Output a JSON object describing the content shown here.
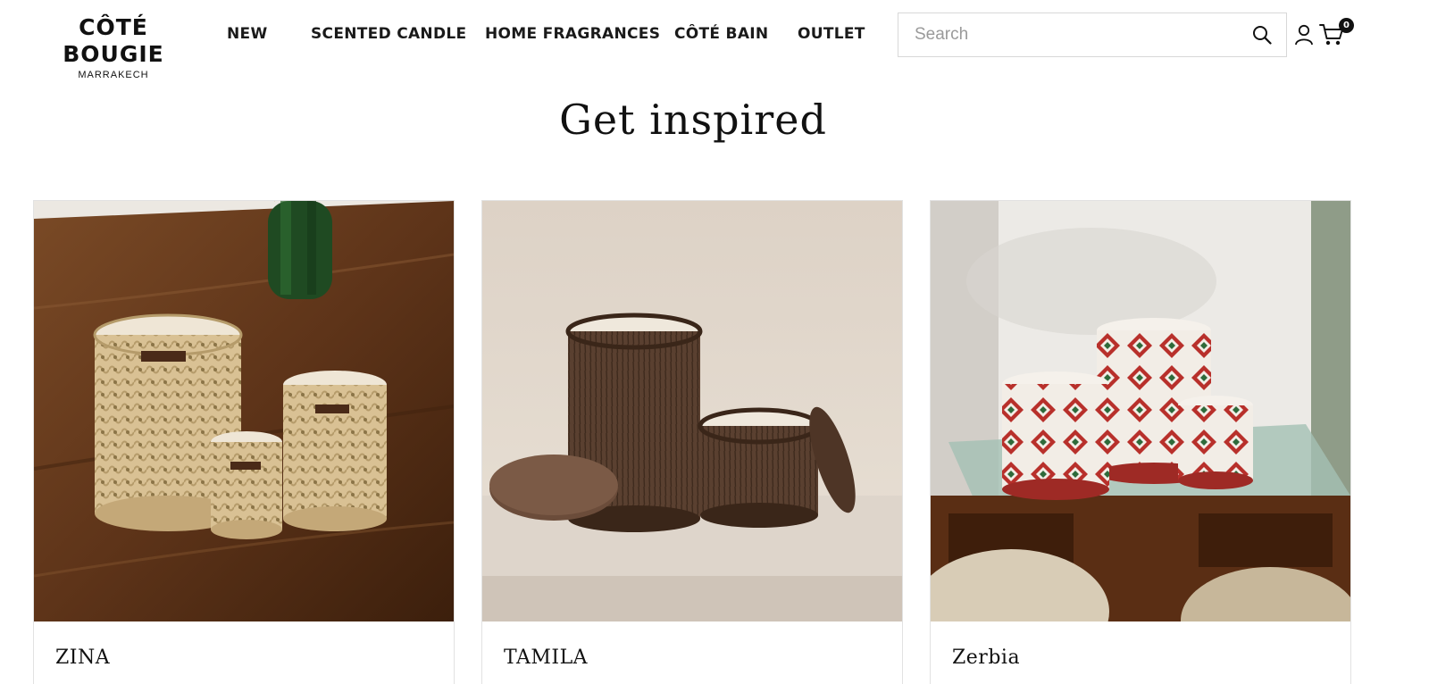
{
  "header": {
    "logo": {
      "main": "CÔTÉ BOUGIE",
      "sub": "MARRAKECH"
    },
    "nav": [
      {
        "label": "NEW"
      },
      {
        "label": "SCENTED CANDLE"
      },
      {
        "label": "HOME FRAGRANCES"
      },
      {
        "label": "CÔTÉ BAIN"
      },
      {
        "label": "OUTLET"
      }
    ],
    "search": {
      "placeholder": "Search",
      "value": ""
    },
    "icons": {
      "search": "search-icon",
      "account": "user-icon",
      "cart": "cart-icon"
    },
    "cart_count": "0"
  },
  "main": {
    "title": "Get inspired",
    "cards": [
      {
        "name": "ZINA",
        "image": "crochet-basket-candles-on-wooden-table"
      },
      {
        "name": "TAMILA",
        "image": "brown-ceramic-candles-with-lids"
      },
      {
        "name": "Zerbia",
        "image": "berber-pattern-candles-on-carved-table"
      }
    ]
  },
  "colors": {
    "text": "#111111",
    "border": "#e2e2e2",
    "badge": "#111111"
  }
}
